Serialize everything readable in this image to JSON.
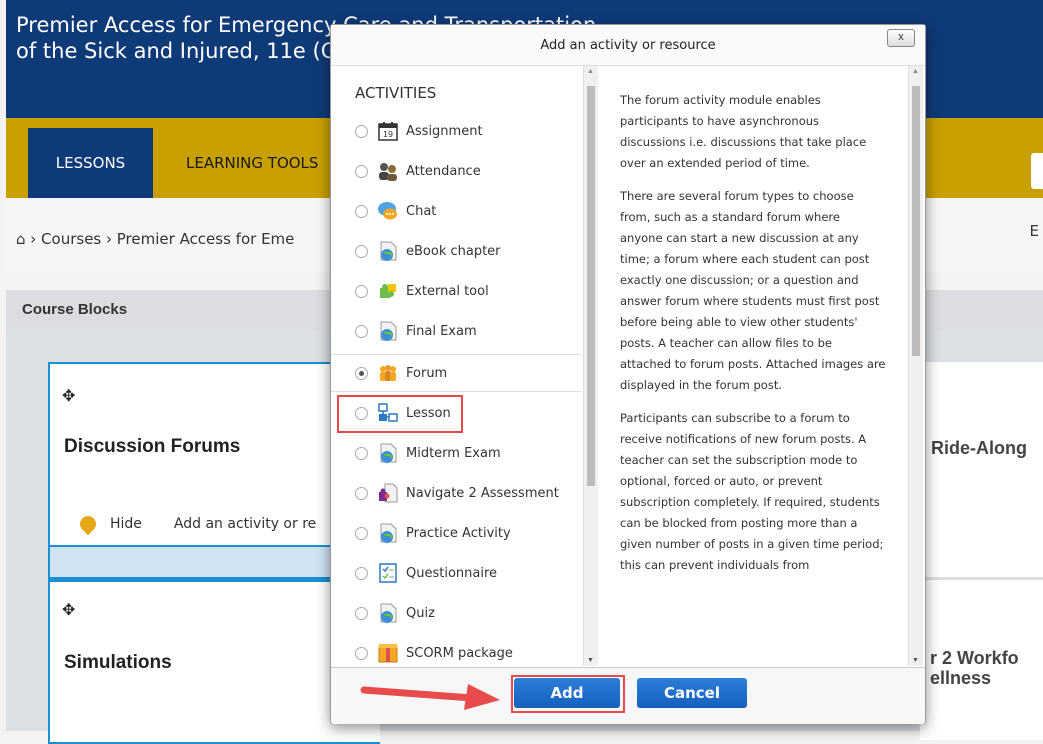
{
  "page": {
    "course_title": "Premier Access for Emergency Care and Transportation\nof the Sick and Injured, 11e (G",
    "nav": {
      "lessons": "LESSONS",
      "learning_tools": "LEARNING TOOLS"
    },
    "breadcrumb": {
      "text": "⌂  ›  Courses  ›  Premier Access for Eme",
      "right": "E"
    },
    "course_blocks": "Course Blocks",
    "cards": {
      "discussion_title": "Discussion Forums",
      "hide": "Hide",
      "add_activity": "Add an activity or re",
      "simulations_title": "Simulations",
      "right_1": "Ride-Along",
      "right_2_line1": "r 2 Workfo",
      "right_2_line2": "ellness",
      "move_symbol": "✥"
    }
  },
  "modal": {
    "title": "Add an activity or resource",
    "close": "x",
    "heading": "ACTIVITIES",
    "options": [
      {
        "label": "Assignment",
        "icon": "calendar-icon",
        "checked": false
      },
      {
        "label": "Attendance",
        "icon": "people-icon",
        "checked": false
      },
      {
        "label": "Chat",
        "icon": "chat-bubble-icon",
        "checked": false
      },
      {
        "label": "eBook chapter",
        "icon": "page-globe-icon",
        "checked": false
      },
      {
        "label": "External tool",
        "icon": "puzzle-icon",
        "checked": false
      },
      {
        "label": "Final Exam",
        "icon": "page-globe-icon",
        "checked": false
      },
      {
        "label": "Forum",
        "icon": "forum-people-icon",
        "checked": true
      },
      {
        "label": "Lesson",
        "icon": "lesson-flow-icon",
        "checked": false
      },
      {
        "label": "Midterm Exam",
        "icon": "page-globe-icon",
        "checked": false
      },
      {
        "label": "Navigate 2 Assessment",
        "icon": "puzzle-page-icon",
        "checked": false
      },
      {
        "label": "Practice Activity",
        "icon": "page-globe-icon",
        "checked": false
      },
      {
        "label": "Questionnaire",
        "icon": "checklist-icon",
        "checked": false
      },
      {
        "label": "Quiz",
        "icon": "page-globe-icon",
        "checked": false
      },
      {
        "label": "SCORM package",
        "icon": "package-icon",
        "checked": false
      }
    ],
    "description": [
      "The forum activity module enables participants to have asynchronous discussions i.e. discussions that take place over an extended period of time.",
      "There are several forum types to choose from, such as a standard forum where anyone can start a new discussion at any time; a forum where each student can post exactly one discussion; or a question and answer forum where students must first post before being able to view other students' posts. A teacher can allow files to be attached to forum posts. Attached images are displayed in the forum post.",
      "Participants can subscribe to a forum to receive notifications of new forum posts. A teacher can set the subscription mode to optional, forced or auto, or prevent subscription completely. If required, students can be blocked from posting more than a given number of posts in a given time period; this can prevent individuals from"
    ],
    "buttons": {
      "add": "Add",
      "cancel": "Cancel"
    }
  },
  "colors": {
    "header": "#0f3a78",
    "navbar": "#c8a000",
    "button": "#1560bd",
    "highlight": "#e84b4b"
  }
}
